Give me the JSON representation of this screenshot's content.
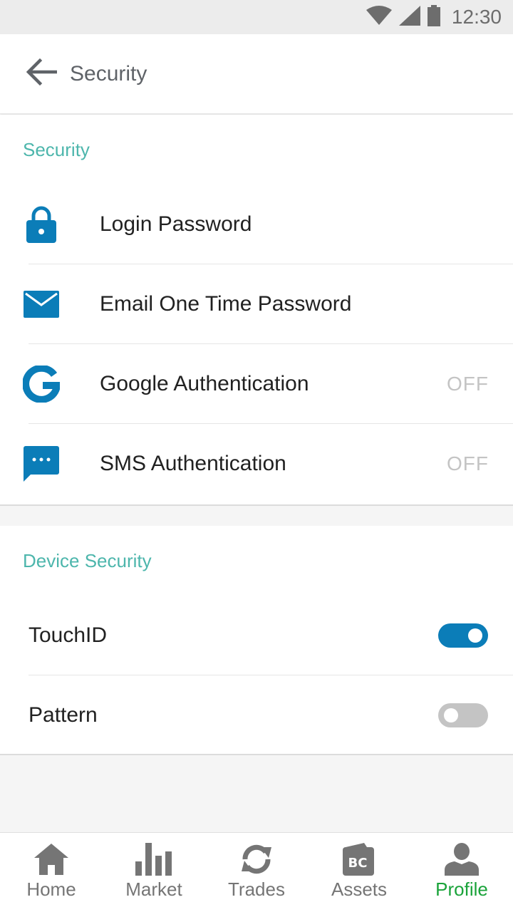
{
  "status_bar": {
    "time": "12:30"
  },
  "app_bar": {
    "title": "Security"
  },
  "security_section": {
    "header": "Security",
    "items": [
      {
        "label": "Login Password",
        "value": "",
        "icon": "lock-icon"
      },
      {
        "label": "Email One Time Password",
        "value": "",
        "icon": "email-icon"
      },
      {
        "label": "Google Authentication",
        "value": "OFF",
        "icon": "google-icon"
      },
      {
        "label": "SMS Authentication",
        "value": "OFF",
        "icon": "sms-icon"
      }
    ]
  },
  "device_section": {
    "header": "Device Security",
    "items": [
      {
        "label": "TouchID",
        "enabled": true
      },
      {
        "label": "Pattern",
        "enabled": false
      }
    ]
  },
  "bottom_nav": {
    "items": [
      {
        "label": "Home",
        "icon": "home-icon",
        "active": false
      },
      {
        "label": "Market",
        "icon": "bar-chart-icon",
        "active": false
      },
      {
        "label": "Trades",
        "icon": "refresh-icon",
        "active": false
      },
      {
        "label": "Assets",
        "icon": "wallet-icon",
        "active": false
      },
      {
        "label": "Profile",
        "icon": "person-icon",
        "active": true
      }
    ]
  },
  "colors": {
    "accent_teal": "#4db6ac",
    "icon_blue": "#0b7db8",
    "active_green": "#1aa33a",
    "off_text": "#c4c4c4"
  }
}
